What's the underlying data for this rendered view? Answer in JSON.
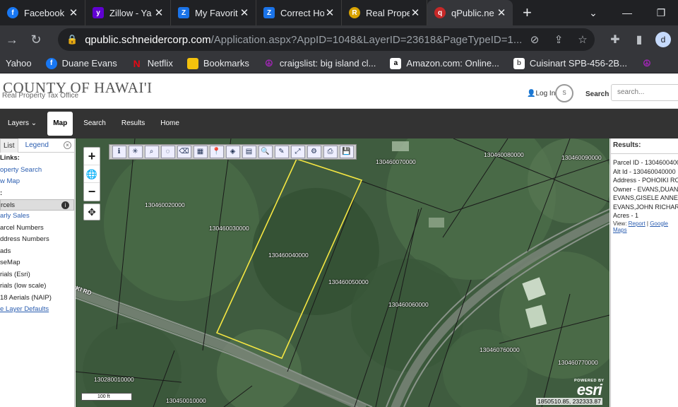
{
  "browser": {
    "tabs": [
      {
        "title": "Facebook",
        "color": "#1877f2",
        "glyph": "f"
      },
      {
        "title": "Zillow - Ya",
        "color": "#6001d2",
        "glyph": "y"
      },
      {
        "title": "My Favorit",
        "color": "#1a73e8",
        "glyph": "Z"
      },
      {
        "title": "Correct Ho",
        "color": "#1a73e8",
        "glyph": "Z"
      },
      {
        "title": "Real Prope",
        "color": "#d9a300",
        "glyph": "R"
      },
      {
        "title": "qPublic.ne",
        "color": "#c62828",
        "glyph": "q"
      }
    ],
    "new_tab": "+",
    "url_host": "qpublic.schneidercorp.com",
    "url_path": "/Application.aspx?AppID=1048&LayerID=23618&PageTypeID=1...",
    "profile": "d",
    "bookmarks": [
      {
        "label": "Yahoo",
        "color": "",
        "glyph": ""
      },
      {
        "label": "Duane Evans",
        "color": "#1877f2",
        "glyph": "f"
      },
      {
        "label": "Netflix",
        "color": "#e50914",
        "glyph": "N"
      },
      {
        "label": "Bookmarks",
        "color": "#f4c20d",
        "glyph": ""
      },
      {
        "label": "craigslist: big island cl...",
        "color": "#7b1fa2",
        "glyph": "☮"
      },
      {
        "label": "Amazon.com: Online...",
        "color": "#ffffff",
        "glyph": "a"
      },
      {
        "label": "Cuisinart SPB-456-2B...",
        "color": "#fff",
        "glyph": "b"
      },
      {
        "label": "",
        "color": "#7b1fa2",
        "glyph": "☮"
      }
    ]
  },
  "header": {
    "logo_title": "COUNTY OF HAWAI'I",
    "logo_subtitle": "Real Property Tax Office",
    "login": "Log In",
    "search_label": "Search",
    "search_placeholder": "search..."
  },
  "nav": [
    "Layers",
    "Map",
    "Search",
    "Results",
    "Home"
  ],
  "left_panel": {
    "tab_list": "List",
    "tab_legend": "Legend",
    "close": "×",
    "rows": [
      {
        "text": "Links:",
        "style": "bold"
      },
      {
        "text": "operty Search",
        "style": "lnk"
      },
      {
        "text": "w Map",
        "style": "lnk"
      },
      {
        "text": ":",
        "style": "bold"
      },
      {
        "text": "rcels",
        "style": "sel"
      },
      {
        "text": "arly Sales",
        "style": "lnk"
      },
      {
        "text": "arcel Numbers",
        "style": ""
      },
      {
        "text": "ddress Numbers",
        "style": ""
      },
      {
        "text": "ads",
        "style": ""
      },
      {
        "text": "seMap",
        "style": ""
      },
      {
        "text": "rials (Esri)",
        "style": ""
      },
      {
        "text": "rials (low scale)",
        "style": ""
      },
      {
        "text": "18 Aerials (NAIP)",
        "style": ""
      },
      {
        "text": "e Layer Defaults",
        "style": "ul"
      }
    ]
  },
  "map": {
    "parcels": [
      "130460020000",
      "130460030000",
      "130460040000",
      "130460050000",
      "130460060000",
      "130460070000",
      "130460080000",
      "130460090000",
      "130460760000",
      "130460770000",
      "130280010000",
      "130450010000"
    ],
    "road_label": "KI RD",
    "scale": "100 ft",
    "coords": "1850510.85, 232333.87",
    "esri_powered": "POWERED BY",
    "esri_name": "esri"
  },
  "results": {
    "title": "Results:",
    "lines": [
      "Parcel ID - 1304600400",
      "Alt Id - 130460040000",
      "Address - POHOIKI ROA",
      "Owner - EVANS,DUANE",
      "EVANS,GISELE ANNETT",
      "EVANS,JOHN RICHARD",
      "Acres - 1"
    ],
    "view_label": "View:",
    "report_link": "Report",
    "maps_link": "Google Maps"
  }
}
